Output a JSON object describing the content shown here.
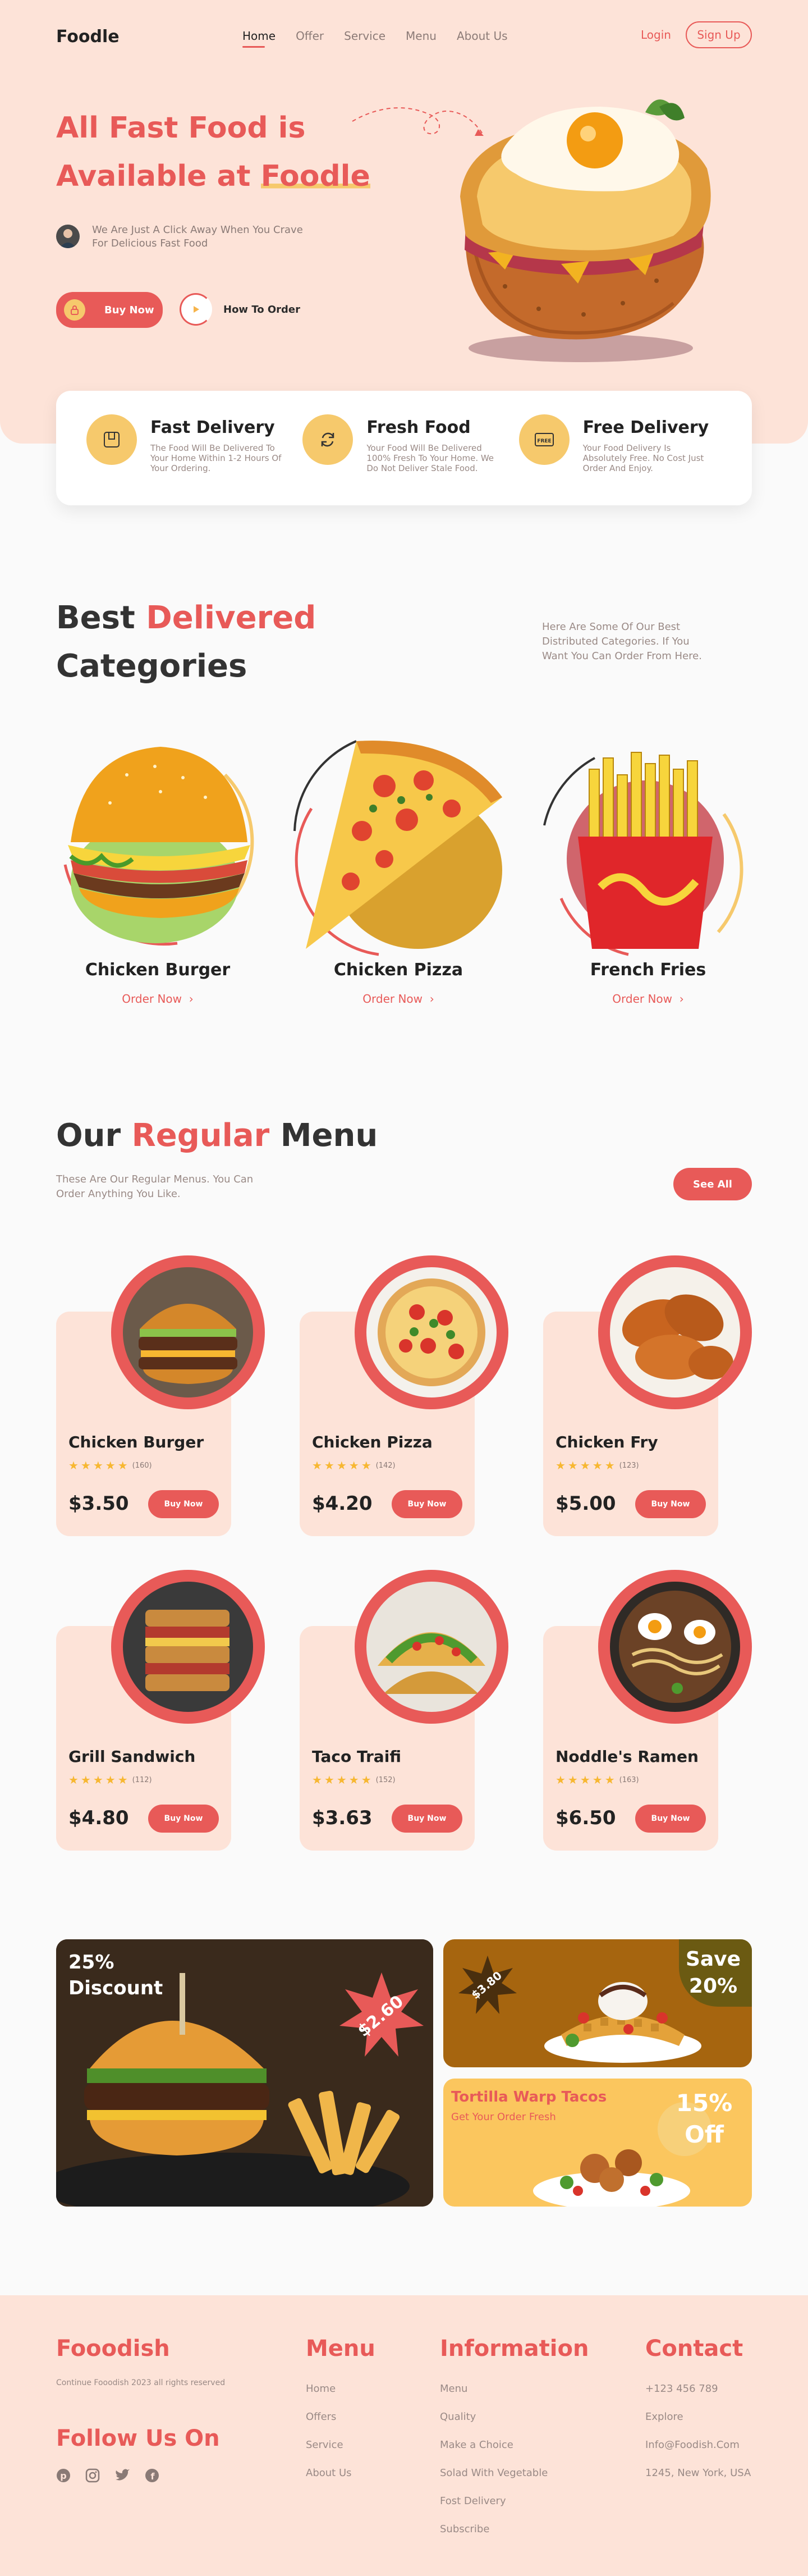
{
  "header": {
    "logo": "Foodle",
    "nav": [
      "Home",
      "Offer",
      "Service",
      "Menu",
      "About Us"
    ],
    "login": "Login",
    "signup": "Sign Up"
  },
  "hero": {
    "title_line1": "All Fast Food is",
    "title_line2_prefix": "Available at ",
    "title_highlight": "Foodle",
    "subtitle": "We Are Just A Click Away When You Crave For Delicious Fast Food",
    "buy_label": "Buy Now",
    "how_label": "How To Order"
  },
  "features": [
    {
      "title": "Fast Delivery",
      "text": "The Food Will Be Delivered To Your Home Within 1-2 Hours Of Your Ordering.",
      "icon": "box-icon"
    },
    {
      "title": "Fresh Food",
      "text": "Your Food Will Be Delivered 100% Fresh To Your Home. We Do Not Deliver Stale Food.",
      "icon": "refresh-icon"
    },
    {
      "title": "Free Delivery",
      "text": "Your Food Delivery Is Absolutely Free. No Cost Just Order And Enjoy.",
      "icon": "free-tag-icon"
    }
  ],
  "categories_section": {
    "title_prefix": "Best ",
    "title_highlight": "Delivered",
    "title_line2": "Categories",
    "description": "Here Are Some Of Our Best Distributed Categories. If You Want You Can Order From Here.",
    "items": [
      {
        "name": "Chicken Burger",
        "cta": "Order Now"
      },
      {
        "name": "Chicken Pizza",
        "cta": "Order Now"
      },
      {
        "name": "French Fries",
        "cta": "Order Now"
      }
    ]
  },
  "menu_section": {
    "title_prefix": "Our ",
    "title_highlight": "Regular",
    "title_suffix": " Menu",
    "description": "These Are Our Regular Menus. You Can Order Anything You Like.",
    "see_all": "See All",
    "items": [
      {
        "name": "Chicken Burger",
        "reviews": "(160)",
        "price": "$3.50",
        "cta": "Buy Now"
      },
      {
        "name": "Chicken Pizza",
        "reviews": "(142)",
        "price": "$4.20",
        "cta": "Buy Now"
      },
      {
        "name": "Chicken Fry",
        "reviews": "(123)",
        "price": "$5.00",
        "cta": "Buy Now"
      },
      {
        "name": "Grill Sandwich",
        "reviews": "(112)",
        "price": "$4.80",
        "cta": "Buy Now"
      },
      {
        "name": "Taco Traifi",
        "reviews": "(152)",
        "price": "$3.63",
        "cta": "Buy Now"
      },
      {
        "name": "Noddle's Ramen",
        "reviews": "(163)",
        "price": "$6.50",
        "cta": "Buy Now"
      }
    ]
  },
  "promos": {
    "p1_line1": "25%",
    "p1_line2": "Discount",
    "p1_price": "$2.60",
    "p2_price": "$3.80",
    "p2_line1": "Save",
    "p2_line2": "20%",
    "p3_title": "Tortilla Warp Tacos",
    "p3_sub": "Get Your Order Fresh",
    "p3_line1": "15%",
    "p3_line2": "Off"
  },
  "footer": {
    "brand": "Fooodish",
    "copyright": "Continue Fooodish 2023 all rights reserved",
    "follow": "Follow Us On",
    "menu_title": "Menu",
    "menu_links": [
      "Home",
      "Offers",
      "Service",
      "About Us"
    ],
    "info_title": "Information",
    "info_links": [
      "Menu",
      "Quality",
      "Make a Choice",
      "Solad With Vegetable",
      "Fost Delivery",
      "Subscribe"
    ],
    "contact_title": "Contact",
    "contact_lines": [
      "+123 456 789",
      "Explore",
      "Info@Foodish.Com",
      "1245, New York, USA"
    ],
    "social": [
      "pinterest-icon",
      "instagram-icon",
      "twitter-icon",
      "facebook-icon"
    ]
  },
  "colors": {
    "accent": "#e85a58",
    "yellow": "#f6c96c",
    "peach": "#fde3d8"
  }
}
